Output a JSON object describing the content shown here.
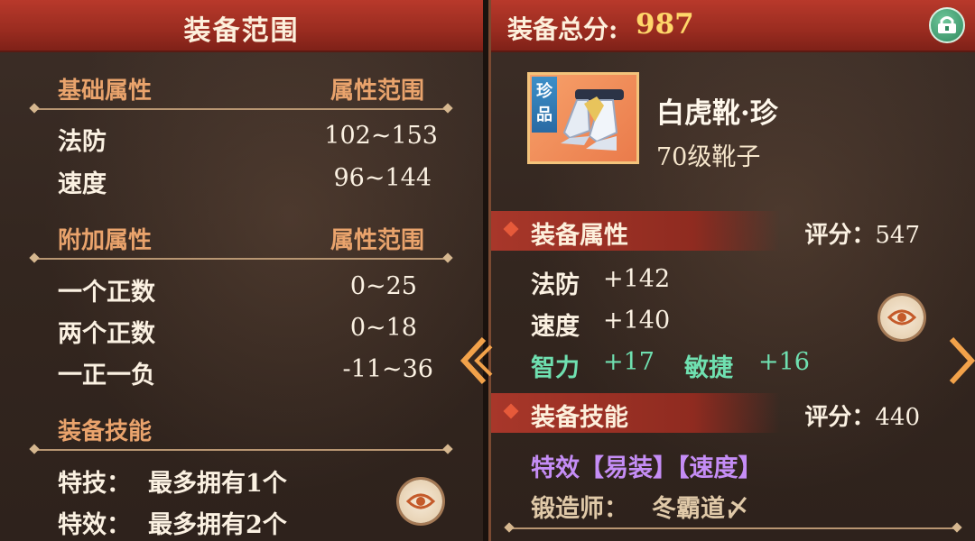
{
  "left": {
    "title": "装备范围",
    "base": {
      "heading": "基础属性",
      "range_heading": "属性范围",
      "rows": [
        {
          "label": "法防",
          "value": "102~153"
        },
        {
          "label": "速度",
          "value": "96~144"
        }
      ]
    },
    "extra": {
      "heading": "附加属性",
      "range_heading": "属性范围",
      "rows": [
        {
          "label": "一个正数",
          "value": "0~25"
        },
        {
          "label": "两个正数",
          "value": "0~18"
        },
        {
          "label": "一正一负",
          "value": "-11~36"
        }
      ]
    },
    "skills": {
      "heading": "装备技能",
      "rows": [
        {
          "label": "特技：",
          "value": "最多拥有1个"
        },
        {
          "label": "特效：",
          "value": "最多拥有2个"
        }
      ]
    }
  },
  "right": {
    "total_label": "装备总分:",
    "total_value": "987",
    "item": {
      "rarity": "珍品",
      "rarity_1": "珍",
      "rarity_2": "品",
      "name": "白虎靴·珍",
      "type": "70级靴子"
    },
    "attributes": {
      "heading": "装备属性",
      "score_label": "评分：",
      "score_value": "547",
      "rows": [
        {
          "label": "法防",
          "value": "+142"
        },
        {
          "label": "速度",
          "value": "+140"
        }
      ],
      "bonus": [
        {
          "label": "智力",
          "value": "+17"
        },
        {
          "label": "敏捷",
          "value": "+16"
        }
      ]
    },
    "skills": {
      "heading": "装备技能",
      "score_label": "评分：",
      "score_value": "440",
      "effect": "特效【易装】【速度】",
      "smith_label": "锻造师：",
      "smith_name": "冬霸道〆"
    }
  },
  "colors": {
    "header": "#9a2c20",
    "section_heading": "#e9a36c",
    "bonus_green": "#6fe0b0",
    "effect_purple": "#c58df6",
    "score_gold": "#ffd76a"
  },
  "icons": [
    "lock-icon",
    "eye-icon",
    "chevron-left-icon",
    "chevron-right-icon",
    "boots-icon"
  ]
}
